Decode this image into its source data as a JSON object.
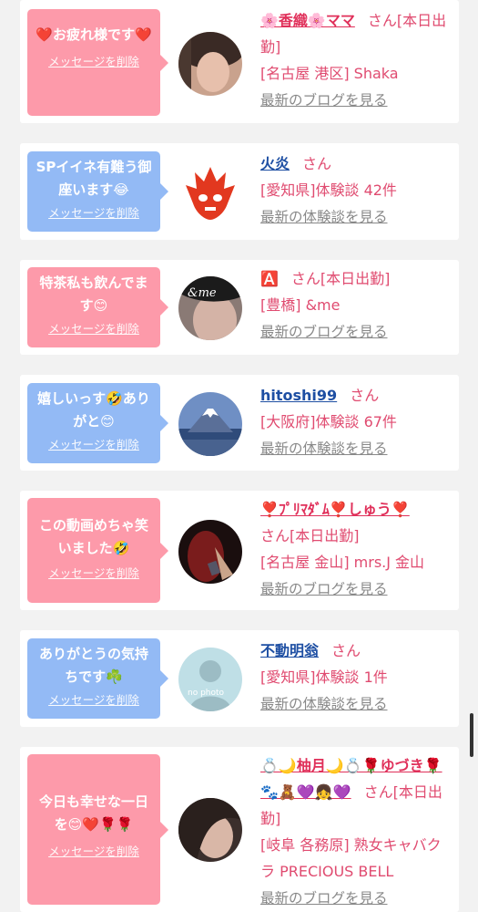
{
  "delete_label": "メッセージを削除",
  "san": "さん",
  "colors": {
    "pink_bubble": "#fd9aaa",
    "blue_bubble": "#93baf5",
    "pink_text": "#e04b70",
    "blue_link": "#1e4fa3"
  },
  "items": [
    {
      "message": "❤️お疲れ様です❤️",
      "name": "🌸香織🌸ママ",
      "tail": "さん[本日出勤]",
      "location": "[名古屋 港区] Shaka",
      "link": "最新のブログを見る"
    },
    {
      "message": "SPイイネ有難う御座います😂",
      "name": "火炎",
      "tail": "さん",
      "location": "[愛知県]体験談 42件",
      "link": "最新の体験談を見る"
    },
    {
      "message": "特茶私も飲んでます😊",
      "name": "🅰️",
      "tail": "さん[本日出勤]",
      "location": "[豊橋] &me",
      "link": "最新のブログを見る"
    },
    {
      "message": "嬉しいっす🤣ありがと😊",
      "name": "hitoshi99",
      "tail": "さん",
      "location": "[大阪府]体験談 67件",
      "link": "最新の体験談を見る"
    },
    {
      "message": "この動画めちゃ笑いました🤣",
      "name": "❣️ﾌﾟﾘﾏﾀﾞﾑ❣️しゅう❣️",
      "tail": "さん[本日出勤]",
      "location": "[名古屋 金山] mrs.J 金山",
      "link": "最新のブログを見る"
    },
    {
      "message": "ありがとうの気持ちです☘️",
      "name": "不動明翁",
      "tail": "さん",
      "location": "[愛知県]体験談 1件",
      "link": "最新の体験談を見る"
    },
    {
      "message": "今日も幸せな一日を😊❤️🌹🌹",
      "name": "💍🌙柚月🌙💍🌹ゆづき🌹🐾🧸💜👧💜",
      "tail": "さん[本日出勤]",
      "location": "[岐阜 各務原] 熟女キャバクラ PRECIOUS BELL",
      "link": "最新のブログを見る"
    }
  ],
  "avatar_labels": {
    "no_photo": "no photo",
    "andme": "&me"
  }
}
